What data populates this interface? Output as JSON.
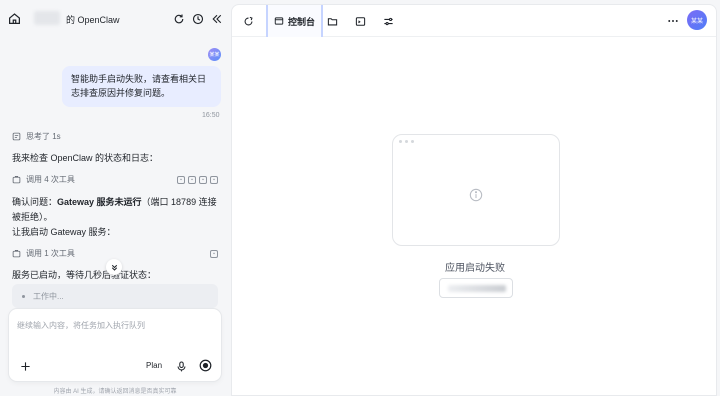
{
  "left": {
    "session_title": "的 OpenClaw",
    "user_avatar_label": "某某",
    "user_message": "智能助手启动失败，请查看相关日志排查原因并修复问题。",
    "message_time": "16:50",
    "thought_label": "思考了 1s",
    "para1": "我来检查 OpenClaw 的状态和日志：",
    "tool_call_1": "调用 4 次工具",
    "para2_prefix": "确认问题：",
    "para2_bold": "Gateway 服务未运行",
    "para2_suffix": "（端口 18789 连接",
    "para2_line2": "被拒绝）。",
    "para3": "让我启动 Gateway 服务：",
    "tool_call_2": "调用 1 次工具",
    "para4": "服务已启动，等待几秒后验证状态：",
    "working_label": "工作中...",
    "input_placeholder": "继续输入内容，将任务加入执行队列",
    "plan_label": "Plan",
    "disclaimer": "内容由 AI 生成，请确认返回消息是否真实可靠"
  },
  "right": {
    "active_tab_label": "控制台",
    "avatar_label": "某某",
    "empty_title": "应用启动失败"
  },
  "colors": {
    "accent": "#5b6ef5",
    "bubble": "#e8edff"
  }
}
